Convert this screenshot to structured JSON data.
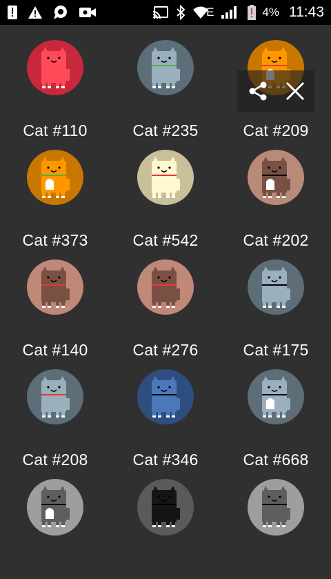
{
  "status_bar": {
    "battery_percent": "4%",
    "time": "11:43",
    "network_type": "E",
    "icons": [
      "alert-icon",
      "warning-icon",
      "chat-icon",
      "video-icon",
      "cast-icon",
      "bluetooth-icon",
      "wifi-icon",
      "signal-icon",
      "battery-low-icon"
    ]
  },
  "cats": [
    {
      "name": "Cat #110",
      "bg": "#c8283c",
      "body": "#ff4a5a",
      "collar": "",
      "chest": false
    },
    {
      "name": "Cat #235",
      "bg": "#5b6e7a",
      "body": "#9ab0bc",
      "collar": "#4caf50",
      "chest": false
    },
    {
      "name": "Cat #209",
      "bg": "#c87800",
      "body": "#ff9800",
      "collar": "#e53935",
      "chest": true
    },
    {
      "name": "Cat #373",
      "bg": "#c87800",
      "body": "#ff9800",
      "collar": "#4caf50",
      "chest": true
    },
    {
      "name": "Cat #542",
      "bg": "#c9c09a",
      "body": "#fff8d0",
      "collar": "#e53935",
      "chest": false
    },
    {
      "name": "Cat #202",
      "bg": "#b88a7a",
      "body": "#7a5044",
      "collar": "#000000",
      "chest": true
    },
    {
      "name": "Cat #140",
      "bg": "#c08878",
      "body": "#7a5044",
      "collar": "#e53935",
      "chest": false
    },
    {
      "name": "Cat #276",
      "bg": "#c08878",
      "body": "#7a5044",
      "collar": "#e53935",
      "chest": false
    },
    {
      "name": "Cat #175",
      "bg": "#5d6e78",
      "body": "#9ab0bc",
      "collar": "#000000",
      "chest": false
    },
    {
      "name": "Cat #208",
      "bg": "#5d6e78",
      "body": "#9ab0bc",
      "collar": "#e53935",
      "chest": false
    },
    {
      "name": "Cat #346",
      "bg": "#2e4e80",
      "body": "#4a78b8",
      "collar": "#000000",
      "chest": false
    },
    {
      "name": "Cat #668",
      "bg": "#5d6e78",
      "body": "#9ab0bc",
      "collar": "#000000",
      "chest": true
    },
    {
      "name": "",
      "bg": "#9e9e9e",
      "body": "#5e5e5e",
      "collar": "#000000",
      "chest": true
    },
    {
      "name": "",
      "bg": "#5a5a5a",
      "body": "#151515",
      "collar": "#000000",
      "chest": false
    },
    {
      "name": "",
      "bg": "#9e9e9e",
      "body": "#5e5e5e",
      "collar": "#000000",
      "chest": false
    }
  ],
  "overlay": {
    "share_icon": "share-icon",
    "close_icon": "close-icon"
  }
}
